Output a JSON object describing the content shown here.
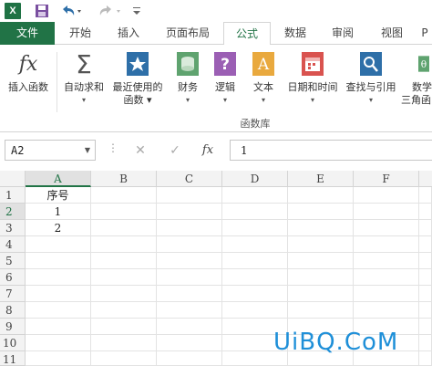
{
  "qat": {
    "save": "save-icon",
    "undo": "undo-icon",
    "redo": "redo-icon"
  },
  "tabs": [
    {
      "label": "文件"
    },
    {
      "label": "开始"
    },
    {
      "label": "插入"
    },
    {
      "label": "页面布局"
    },
    {
      "label": "公式"
    },
    {
      "label": "数据"
    },
    {
      "label": "审阅"
    },
    {
      "label": "视图"
    },
    {
      "label": "P"
    }
  ],
  "ribbon": {
    "insert_function": "插入函数",
    "autosum": "自动求和",
    "recent": "最近使用的",
    "recent2": "函数",
    "finance": "财务",
    "logic": "逻辑",
    "text": "文本",
    "datetime": "日期和时间",
    "lookup": "查找与引用",
    "math": "数学",
    "math2": "三角函",
    "group_label": "函数库"
  },
  "formula_bar": {
    "name_box": "A2",
    "fx": "fx",
    "value": "1"
  },
  "grid": {
    "columns": [
      "A",
      "B",
      "C",
      "D",
      "E",
      "F"
    ],
    "rows": [
      "1",
      "2",
      "3",
      "4",
      "5",
      "6",
      "7",
      "8",
      "9",
      "10",
      "11"
    ],
    "cells": {
      "A1": "序号",
      "A2": "1",
      "A3": "2"
    }
  },
  "watermark": "UiBQ.CoM",
  "colors": {
    "accent": "#217346",
    "ribbon_icon_blue": "#2e6fa8"
  }
}
